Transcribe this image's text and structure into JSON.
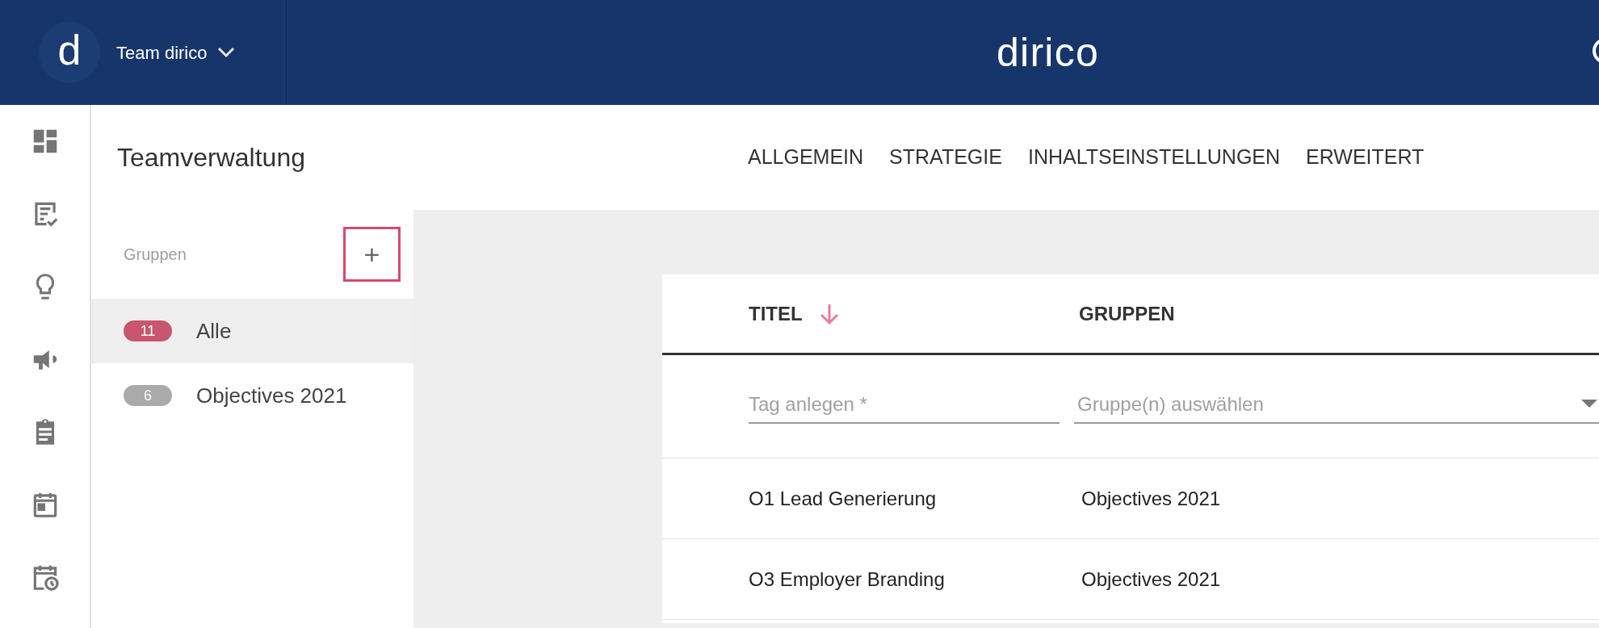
{
  "header": {
    "logo_letter": "d",
    "team": "Team dirico",
    "wordmark": "dirico"
  },
  "page_title": "Teamverwaltung",
  "tabs": [
    {
      "label": "ALLGEMEIN"
    },
    {
      "label": "STRATEGIE"
    },
    {
      "label": "INHALTSEINSTELLUNGEN"
    },
    {
      "label": "ERWEITERT"
    }
  ],
  "groups": {
    "heading": "Gruppen",
    "add_label": "+",
    "items": [
      {
        "count": "11",
        "name": "Alle",
        "selected": true
      },
      {
        "count": "6",
        "name": "Objectives 2021",
        "selected": false
      }
    ]
  },
  "table": {
    "columns": [
      "TITEL",
      "GRUPPEN"
    ],
    "filters": {
      "tag_placeholder": "Tag anlegen *",
      "group_placeholder": "Gruppe(n) auswählen"
    },
    "rows": [
      [
        "O1 Lead Generierung",
        "Objectives 2021"
      ],
      [
        "O3 Employer Branding",
        "Objectives 2021"
      ]
    ]
  }
}
